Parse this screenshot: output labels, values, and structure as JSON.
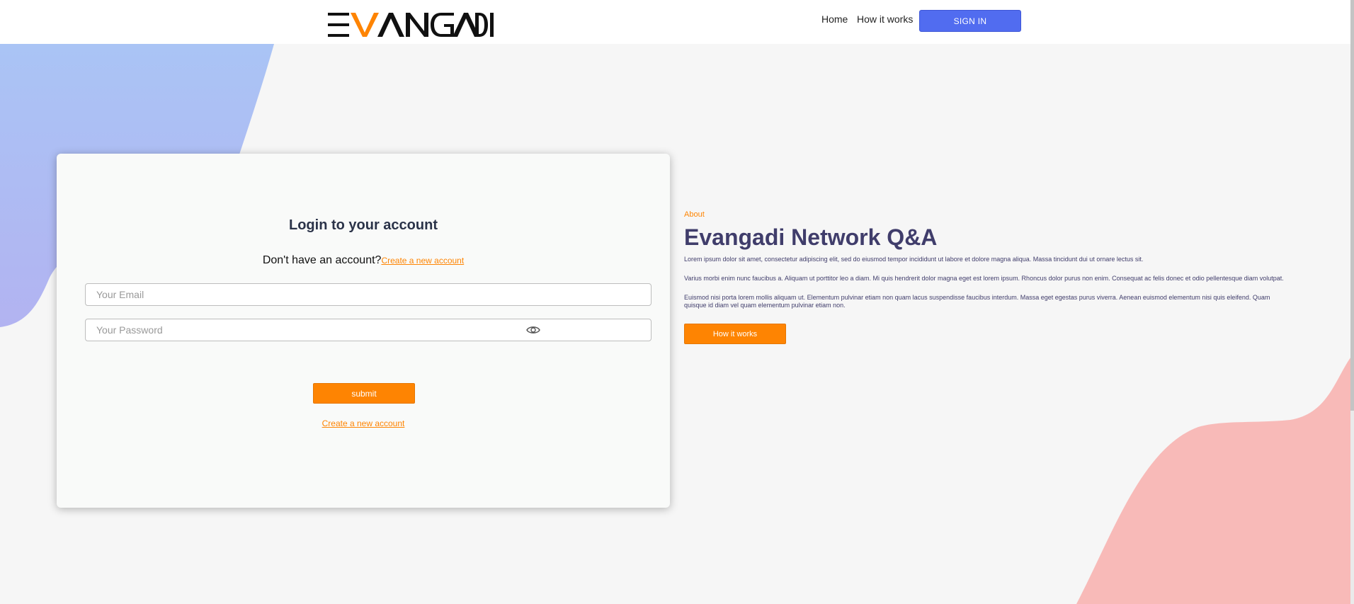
{
  "header": {
    "logo_text": "EVANGADI",
    "nav": {
      "home": "Home",
      "how_it_works": "How it works"
    },
    "sign_in": "SIGN IN"
  },
  "login": {
    "title": "Login to your account",
    "no_account": "Don't have an account?",
    "create_link": "Create a new account",
    "email_placeholder": "Your Email",
    "password_placeholder": "Your Password",
    "submit": "submit",
    "bottom_link": "Create a new account"
  },
  "about": {
    "label": "About",
    "title": "Evangadi Network Q&A",
    "paragraphs": [
      "Lorem ipsum dolor sit amet, consectetur adipiscing elit, sed do eiusmod tempor incididunt ut labore et dolore magna aliqua. Massa tincidunt dui ut ornare lectus sit.",
      "Varius morbi enim nunc faucibus a. Aliquam ut porttitor leo a diam. Mi quis hendrerit dolor magna eget est lorem ipsum. Rhoncus dolor purus non enim. Consequat ac felis donec et odio pellentesque diam volutpat.",
      "Euismod nisi porta lorem mollis aliquam ut. Elementum pulvinar etiam non quam lacus suspendisse faucibus interdum. Massa eget egestas purus viverra. Aenean euismod elementum nisi quis eleifend. Quam quisque id diam vel quam elementum pulvinar etiam non."
    ],
    "button": "How it works"
  },
  "colors": {
    "accent": "#fe8402",
    "primary": "#516cf0",
    "heading": "#403d6b",
    "blob_blue": "#a9bdf4",
    "blob_pink": "#f8bab8"
  },
  "icons": {
    "password_toggle": "eye-icon"
  }
}
